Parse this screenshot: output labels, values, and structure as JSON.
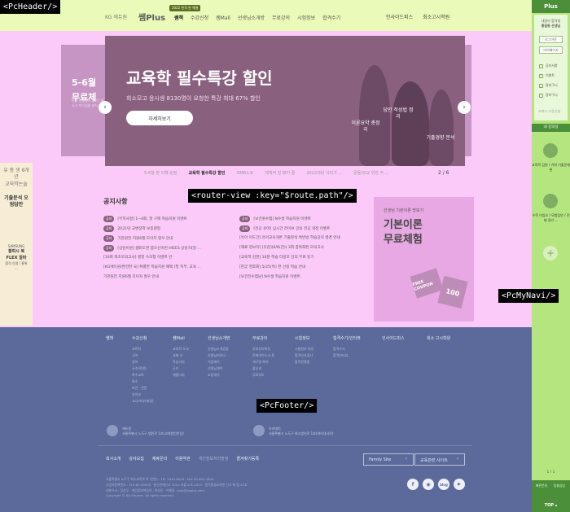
{
  "tags": {
    "header": "<PcHeader/>",
    "main": "<router-view :key=\"$route.path\"/>",
    "nav": "<PcMyNavi/>",
    "footer": "<PcFooter/>"
  },
  "header": {
    "brand_prefix": "KG 에듀원",
    "brand": "쌤Plus",
    "badge": "2022 한격 한 해결",
    "gnb": [
      "쌤책",
      "수강신청",
      "쌤Mall",
      "선생님소개방",
      "무료강의",
      "시험정보",
      "합격수기"
    ],
    "links": [
      "인사이드피스",
      "최소고시학원"
    ]
  },
  "hero": {
    "left_text_1": "5-6월",
    "left_text_2": "무료체",
    "left_small": "이번 선생님의 합격 / 최소고 지식업을 놓치",
    "title": "교육학 필수특강 할인",
    "subtitle": "희소모고 응시생 8130명이 요청한 특강 최대 67% 할인",
    "button": "자세히보기",
    "tags": [
      "이론요약 총정리",
      "답안 작성법 정리",
      "기출경향 분석"
    ],
    "tabs": [
      "5-6월 판 이해 된된",
      "교육학 필수특강 할인",
      "OMR노트",
      "체계적 전 패키 즐",
      "2022대비 이리기 ...",
      "문들/모교 위한 카 ..."
    ],
    "pager": "2 / 6"
  },
  "notice": {
    "title": "공지사항",
    "badge": "공지",
    "left": [
      {
        "badge": true,
        "text": "[무지사항] 1~4회, 첫 구매 학습지원 이벤트"
      },
      {
        "badge": true,
        "text": "2021년 교변장학 보충결정"
      },
      {
        "badge": true,
        "text": "기관원전 지원6월 모이지 할우 안내"
      },
      {
        "badge": true,
        "text": "[상담이원] 쌤미도면 뽑으신이번 HIEES 상담지(정 ..."
      },
      {
        "badge": false,
        "text": "[16회 최초모의고사] 결정 쓰모형 이벤트 안"
      },
      {
        "badge": false,
        "text": "[KG에듀원/완전한 국] 특별한 학습지원 혜택 [첫 지부, 교육 ..."
      },
      {
        "badge": false,
        "text": "기관원전 지원6월 모이자 할우 안내"
      }
    ],
    "right": [
      {
        "badge": true,
        "text": "[보건원수험] N수생 학습지원 이벤트"
      },
      {
        "badge": true,
        "text": "[전공 유아] 심시간 라이브 강의 전공 개정 이벤트"
      },
      {
        "badge": false,
        "text": "[유아 이도간] 유아교육개론 기출분석 특번방 학습강의 병경 안내"
      },
      {
        "badge": false,
        "text": "[재료 정보이] [유감](6/6(전)) 3회 충북화된 모의고사"
      },
      {
        "badge": false,
        "text": "[교육학 김현] 10분 학습 티링모 강의 무료 듯기"
      },
      {
        "badge": false,
        "text": "[한굳 영후회] 5/25(목) 한 선생 학습 안내"
      },
      {
        "badge": false,
        "text": "[보건전수험남] N수생 학습지원 이벤트"
      }
    ]
  },
  "promo": {
    "small": "선생님 기본이론 맛보기",
    "big_1": "기본이론",
    "big_2": "무료체험",
    "coupon_1": "FREE COUPON",
    "coupon_2": "100"
  },
  "left_ad": {
    "g1": "유 충 생 8개년",
    "g1b": "교육학논술",
    "g2": "기출분석 오범답안",
    "brand": "SAMSUNG",
    "sam": "갤럭시 북 FLEX 알파",
    "sam2": "합격 인생 / 홈위 ..."
  },
  "footer": {
    "cols": [
      {
        "h": "쌤책",
        "items": []
      },
      {
        "h": "수강신청",
        "items": [
          "교육학",
          "국어",
          "영어",
          "국수(의한)",
          "특수교육",
          "특수",
          "보건 · 전문",
          "유아교",
          "교사/지부(회원)"
        ]
      },
      {
        "h": "쌤Mall",
        "items": [
          "교육학 도서",
          "교재 서",
          "학습기지",
          "굿즈",
          "체험다지"
        ]
      },
      {
        "h": "선생님소개방",
        "items": [
          "선생님소개검증",
          "선생님커뮤니",
          "기럽게이",
          "선생님게이",
          "쇼핑게이"
        ]
      },
      {
        "h": "무료강의",
        "items": [
          "무료강의특징",
          "문제이이스사 특",
          "세구발 해석",
          "합신과",
          "무료지도"
        ]
      },
      {
        "h": "시험정보",
        "items": [
          "시험정보 특강",
          "합격인사검사",
          "합격전결방"
        ]
      },
      {
        "h": "합격수기/인터뷰",
        "items": [
          "합격수기",
          "합격인터뷰"
        ]
      },
      {
        "h": "인사이드피스",
        "items": []
      },
      {
        "h": "희소 고시학원",
        "items": []
      }
    ],
    "org1_name": "에듀원",
    "org1_text": "서울특별시 노도구 쌤인로 1호(교대법인연상)",
    "org2_name": "아카데미",
    "org2_text": "서울특별시 노도구 희소법인로 1호(여러내서의)",
    "links": [
      "회사소개",
      "강사모집",
      "제휴문의",
      "이용약관",
      "개인정보처리방침",
      "즐겨찾기등록"
    ],
    "select1": "Family Site",
    "select2": "교육관련 사이트",
    "copy_1": "서울특별시 노도구 희소교육로 로 (연연)  ·  TEL 1544-8009  ·  FAX 02-824-1600",
    "copy_2": "사업자등록번호 : 119-81-59000  ·  통신판매신고 2012-서울 노도-0323  ·  원격평생교육원 신고 제 원-41호",
    "copy_3": "대표이사 : 장순무  ·  개인정보책임자 : 박성준  ·  이메일 : edu@kgplus.com",
    "copy_4": "Copyright © KG Eduone. All rights reserved.",
    "sns": [
      "f",
      "◉",
      "blog",
      "▶"
    ]
  },
  "nav": {
    "top": "Plus",
    "user_1": "내일의 합격생",
    "user_2": "홍길동 선생님",
    "btn_1": "로그아웃",
    "btn_2": "마이페이지",
    "items": [
      "공지사항",
      "이벤트",
      "장바구니",
      "장바구니"
    ],
    "apply": "스파크 수강신청",
    "section": "내 강의실",
    "lec1": "교육학 김현 / 키워 기출문제편",
    "lec2": "수학 이임오 / 모범답안 / 전제 정리 ...",
    "plus": "+",
    "bottom_1": "빠른문의",
    "bottom_2": "맞춤상담",
    "top_btn": "TOP ▴",
    "page": "1 / 1"
  }
}
